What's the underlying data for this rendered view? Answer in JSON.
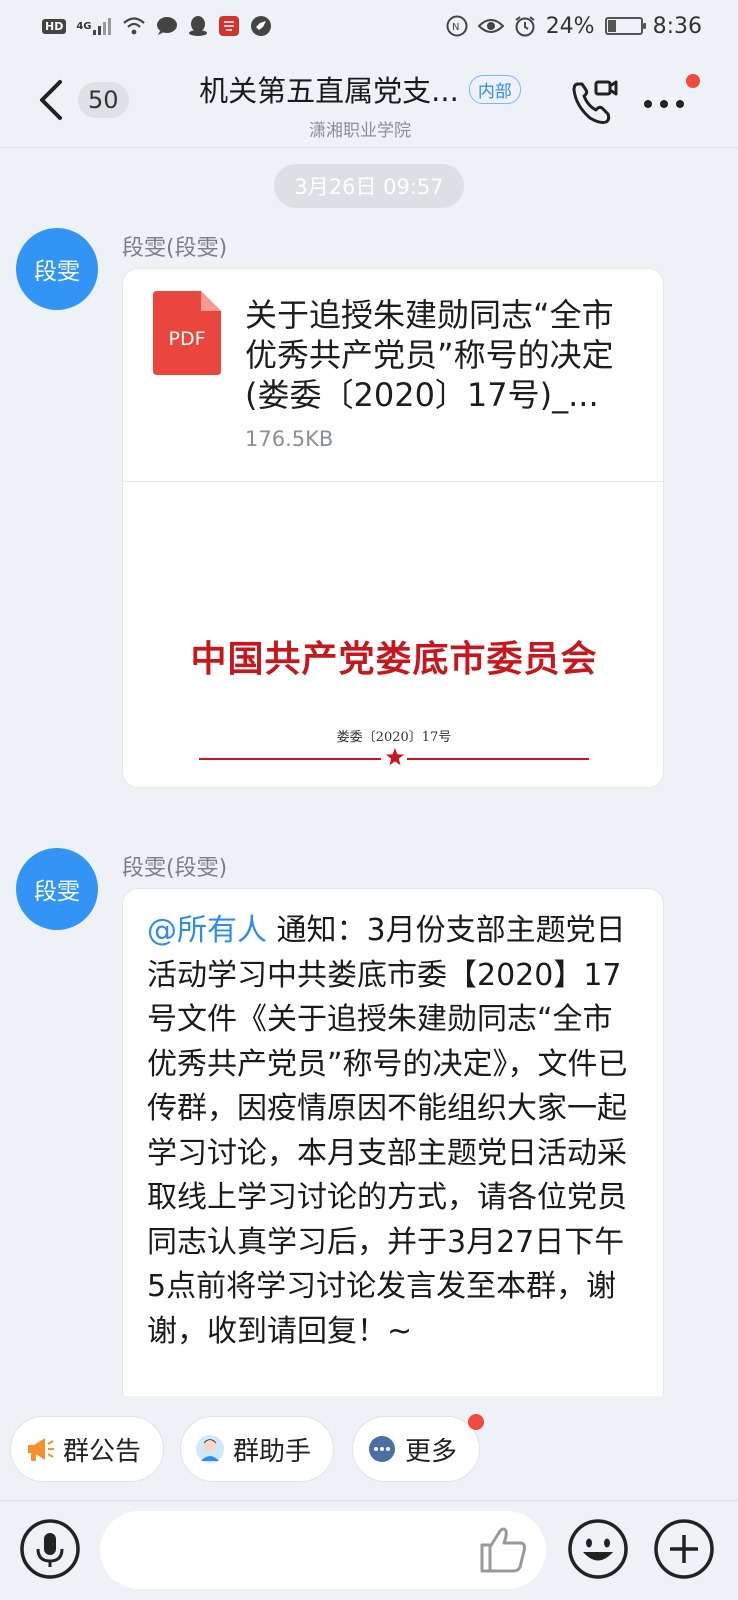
{
  "status_bar": {
    "hd": "HD",
    "network": "4G",
    "battery_text": "24%",
    "battery_level": 0.24,
    "time": "8:36",
    "icons": [
      "hd-icon",
      "signal-icon",
      "wifi-icon",
      "chat-icon",
      "qq-icon",
      "app-icon",
      "shield-icon",
      "nfc-icon",
      "eye-icon",
      "alarm-icon",
      "battery-icon"
    ]
  },
  "header": {
    "back_icon": "chevron-left-icon",
    "unread_count": "50",
    "title": "机关第五直属党支...",
    "tag": "内部",
    "subtitle": "潇湘职业学院",
    "call_icon": "video-call-icon",
    "more_icon": "more-dots-icon"
  },
  "timestamp": "3月26日 09:57",
  "messages": [
    {
      "avatar_text": "段雯",
      "sender": "段雯(段雯)",
      "type": "file",
      "file": {
        "icon_label": "PDF",
        "title": "关于追授朱建勋同志“全市优秀共产党员”称号的决定(娄委〔2020〕17号)_...",
        "size": "176.5KB",
        "preview_org": "中国共产党娄底市委员会",
        "preview_doc_no": "娄委〔2020〕17号"
      }
    },
    {
      "avatar_text": "段雯",
      "sender": "段雯(段雯)",
      "type": "text",
      "mention": "@所有人",
      "body": " 通知：3月份支部主题党日活动学习中共娄底市委【2020】17号文件《关于追授朱建勋同志“全市优秀共产党员”称号的决定》，文件已传群，因疫情原因不能组织大家一起学习讨论，本月支部主题党日活动采取线上学习讨论的方式，请各位党员同志认真学习后，并于3月27日下午5点前将学习讨论发言发至本群，谢谢，收到请回复！~"
    }
  ],
  "quick_actions": [
    {
      "label": "群公告",
      "icon": "megaphone-icon"
    },
    {
      "label": "群助手",
      "icon": "assistant-avatar-icon"
    },
    {
      "label": "更多",
      "icon": "more-circle-icon"
    }
  ],
  "input_bar": {
    "placeholder": "",
    "icons": [
      "microphone-icon",
      "thumbs-up-icon",
      "emoji-icon",
      "plus-icon"
    ]
  },
  "colors": {
    "accent": "#2d8cf0",
    "avatar_bg": "#3294f5",
    "badge_red": "#f04b3a",
    "pdf_red": "#e9473d",
    "doc_red": "#c8161d"
  }
}
